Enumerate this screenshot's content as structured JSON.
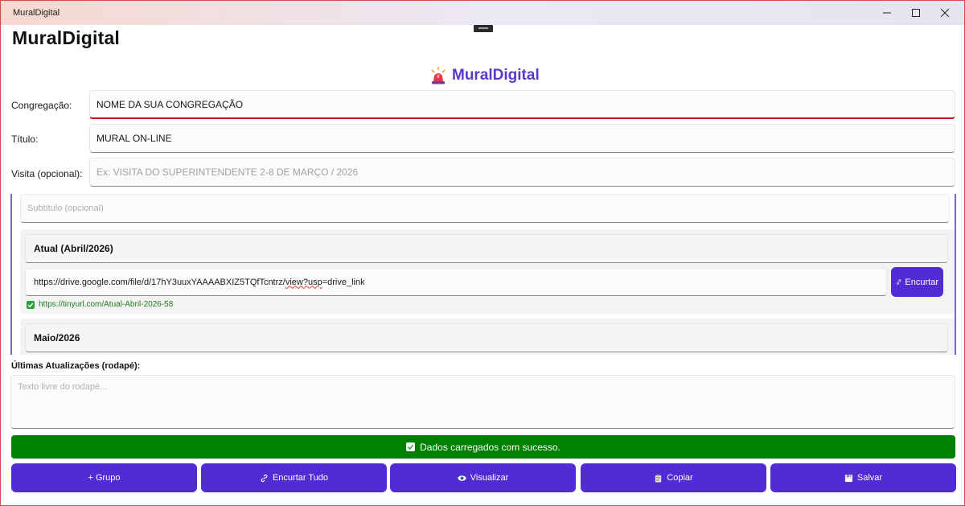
{
  "window": {
    "title": "MuralDigital"
  },
  "app": {
    "title": "MuralDigital",
    "brand": "MuralDigital",
    "brand_icon": "alarm-light-icon"
  },
  "form": {
    "congregation": {
      "label": "Congregação:",
      "value": "NOME DA SUA CONGREGAÇÃO"
    },
    "title": {
      "label": "Título:",
      "value": "MURAL ON-LINE"
    },
    "visit": {
      "label": "Visita (opcional):",
      "placeholder": "Ex: VISITA DO SUPERINTENDENTE 2-8 DE MARÇO / 2026"
    },
    "subtitle": {
      "placeholder": "Subtítulo (opcional)"
    }
  },
  "groups": [
    {
      "name": "Atual (Abril/2026)",
      "url_before": "https://drive.google.com/file/d/17hY3uuxYAAAABXIZ5TQfTcntrz/",
      "url_squiggle": "view?usp",
      "url_after": "=drive_link",
      "shorten_label": "Encurtar",
      "short_url": "https://tinyurl.com/Atual-Abril-2026-58"
    },
    {
      "name": "Maio/2026"
    }
  ],
  "footer": {
    "label": "Últimas Atualizações (rodapé):",
    "placeholder": "Texto livre do rodapé..."
  },
  "status": {
    "text": "Dados carregados com sucesso.",
    "color": "#008000"
  },
  "actions": {
    "add_group": "+ Grupo",
    "shorten_all": "Encurtar Tudo",
    "preview": "Visualizar",
    "copy": "Copiar",
    "save": "Salvar"
  },
  "colors": {
    "accent": "#512bd4",
    "brand_text": "#5b38c9",
    "success": "#008000",
    "focus_underline": "#c50f1f"
  }
}
